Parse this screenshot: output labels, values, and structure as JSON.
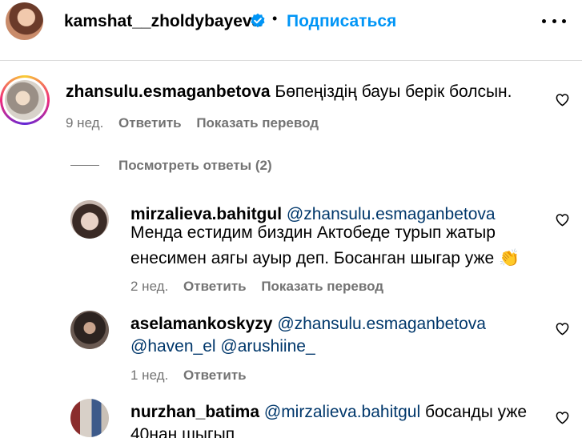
{
  "header": {
    "username": "kamshat__zholdybayeva",
    "separator": "•",
    "follow_label": "Подписаться"
  },
  "comments": [
    {
      "username": "zhansulu.esmaganbetova",
      "text": "Бөпеңіздің бауы берік болсын.",
      "time": "9 нед.",
      "reply_label": "Ответить",
      "translate_label": "Показать перевод"
    }
  ],
  "view_replies_label": "Посмотреть ответы (2)",
  "replies": [
    {
      "username": "mirzalieva.bahitgul",
      "mention": "@zhansulu.esmaganbetova",
      "text_line1": "Менда естидим биздин Актобеде турып жатыр",
      "text_line2": "енесимен аягы ауыр деп. Босанган шыгар уже",
      "emoji": "👏",
      "time": "2 нед.",
      "reply_label": "Ответить",
      "translate_label": "Показать перевод"
    },
    {
      "username": "aselamankoskyzy",
      "mention": "@zhansulu.esmaganbetova",
      "mention2": "@haven_el",
      "mention3": "@arushiine_",
      "time": "1 нед.",
      "reply_label": "Ответить"
    },
    {
      "username": "nurzhan_batima",
      "mention": "@mirzalieva.bahitgul",
      "text_line1": "босанды уже",
      "text_line2": "40нан шыгып"
    }
  ],
  "icons": {
    "verified": "verified-badge-icon",
    "more": "more-options-icon",
    "like": "heart-icon"
  },
  "colors": {
    "link_blue": "#0095f6",
    "mention_blue": "#00376b",
    "secondary_text": "#737373",
    "verified_blue": "#0095f6"
  }
}
